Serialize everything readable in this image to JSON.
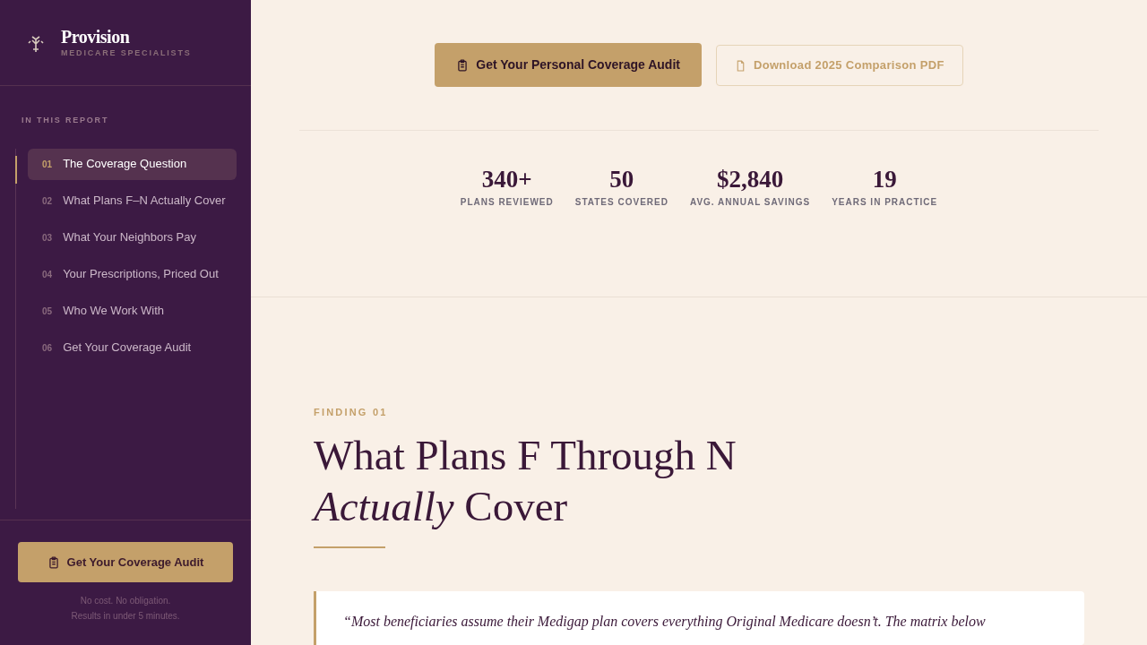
{
  "brand": {
    "name": "Provision",
    "tagline": "MEDICARE SPECIALISTS"
  },
  "toc": {
    "heading": "IN THIS REPORT",
    "items": [
      {
        "number": "01",
        "label": "The Coverage Question",
        "selected": true
      },
      {
        "number": "02",
        "label": "What Plans F–N Actually Cover",
        "selected": false
      },
      {
        "number": "03",
        "label": "What Your Neighbors Pay",
        "selected": false
      },
      {
        "number": "04",
        "label": "Your Prescriptions, Priced Out",
        "selected": false
      },
      {
        "number": "05",
        "label": "Who We Work With",
        "selected": false
      },
      {
        "number": "06",
        "label": "Get Your Coverage Audit",
        "selected": false
      }
    ]
  },
  "sidebar_cta": {
    "button": "Get Your Coverage Audit",
    "note_lines": [
      "No cost. No obligation.",
      "Results in under 5 minutes."
    ]
  },
  "actions": {
    "primary": "Get Your Personal Coverage Audit",
    "secondary": "Download 2025 Comparison PDF"
  },
  "stats": [
    {
      "value": "340+",
      "label": "PLANS REVIEWED"
    },
    {
      "value": "50",
      "label": "STATES COVERED"
    },
    {
      "value": "$2,840",
      "label": "AVG. ANNUAL SAVINGS"
    },
    {
      "value": "19",
      "label": "YEARS IN PRACTICE"
    }
  ],
  "finding": {
    "eyebrow": "FINDING 01",
    "title_line_1": "What Plans F Through N",
    "title_line_2": "*Actually* Cover",
    "quote": "“Most beneficiaries assume their Medigap plan covers everything Original Medicare doesn’t. The matrix below"
  }
}
